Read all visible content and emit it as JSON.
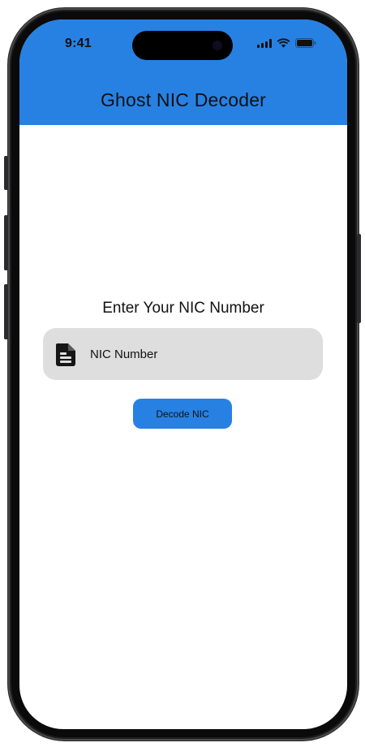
{
  "status_bar": {
    "time": "9:41",
    "icons": [
      "cellular-signal-icon",
      "wifi-icon",
      "battery-icon"
    ]
  },
  "app_bar": {
    "title": "Ghost NIC Decoder",
    "color": "#2781e3"
  },
  "form": {
    "prompt": "Enter Your NIC Number",
    "nic_input": {
      "placeholder": "NIC Number",
      "value": "",
      "icon": "document-icon"
    },
    "decode_button_label": "Decode NIC"
  },
  "colors": {
    "accent": "#2781e3",
    "field_background": "#dedede",
    "text": "#111111"
  }
}
